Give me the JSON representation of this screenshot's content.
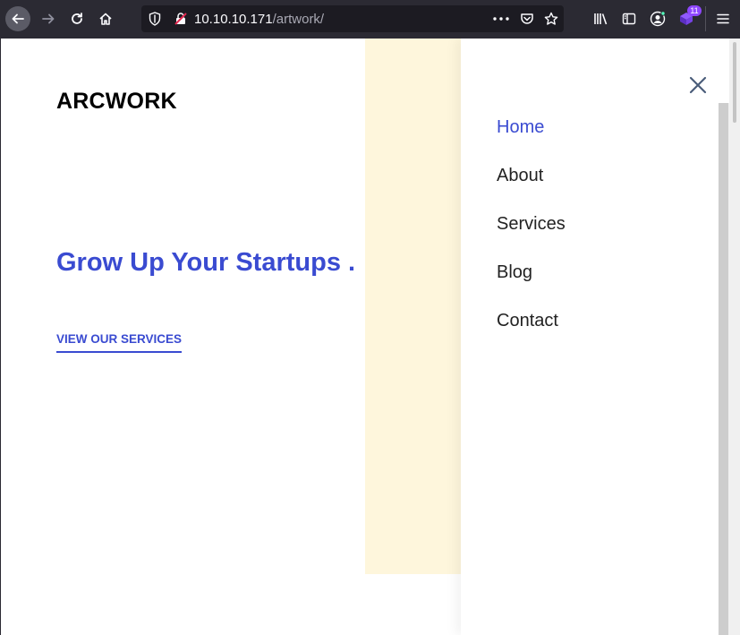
{
  "browser": {
    "url_host": "10.10.10.171",
    "url_path": "/artwork/",
    "extension_badge": "11",
    "icons": [
      "back-icon",
      "forward-icon",
      "reload-icon",
      "home-icon",
      "shield-icon",
      "insecure-lock-icon",
      "more-icon",
      "pocket-icon",
      "star-icon",
      "library-icon",
      "sidebar-icon",
      "account-icon",
      "extension-icon",
      "menu-icon"
    ]
  },
  "site": {
    "logo": "ARCWORK",
    "hero_title": "Grow Up Your Startups .",
    "cta_label": "VIEW OUR SERVICES"
  },
  "menu": {
    "items": [
      {
        "label": "Home",
        "active": true
      },
      {
        "label": "About",
        "active": false
      },
      {
        "label": "Services",
        "active": false
      },
      {
        "label": "Blog",
        "active": false
      },
      {
        "label": "Contact",
        "active": false
      }
    ]
  },
  "colors": {
    "accent": "#3a4bd1",
    "cream": "#fef6dc",
    "toolbar": "#2b2a33"
  }
}
